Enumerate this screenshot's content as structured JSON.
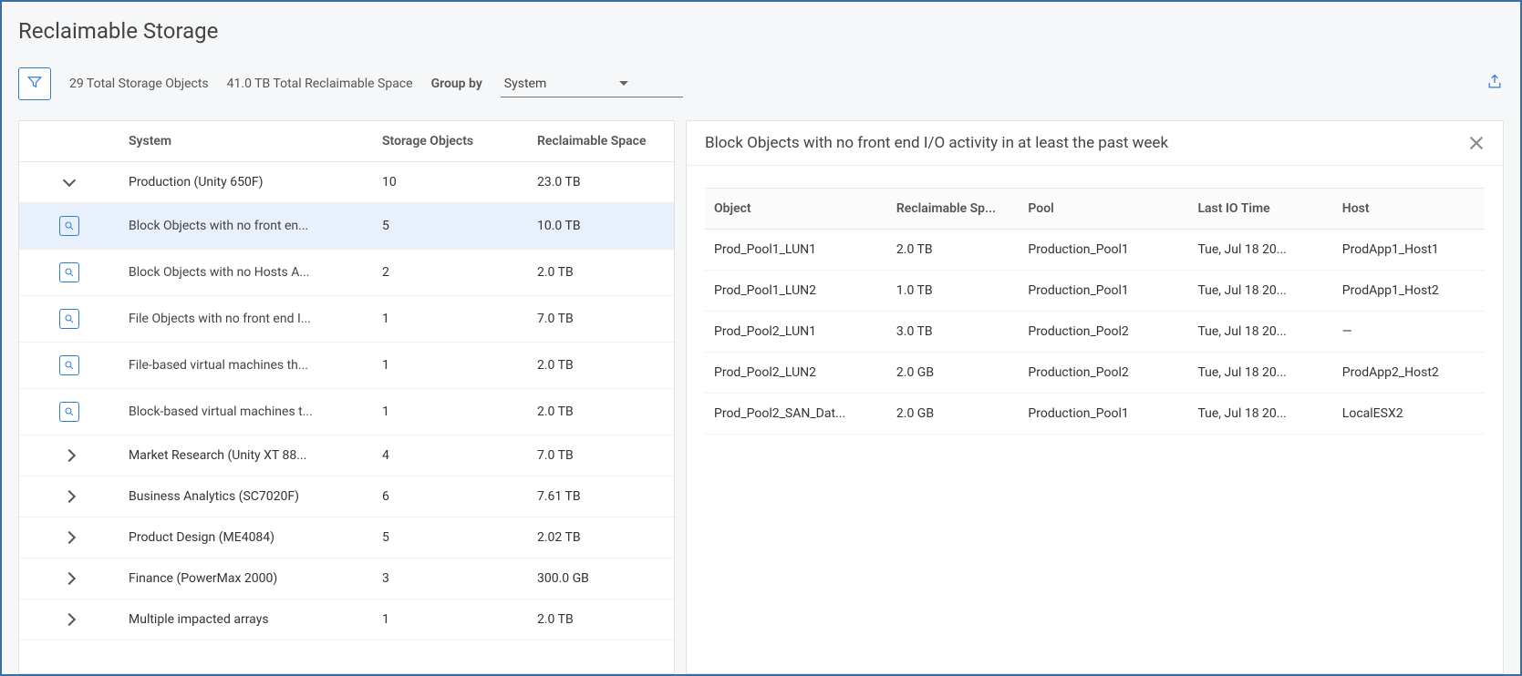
{
  "page_title": "Reclaimable Storage",
  "toolbar": {
    "total_objects": "29 Total Storage Objects",
    "total_reclaimable": "41.0 TB Total Reclaimable Space",
    "group_by_label": "Group by",
    "group_by_value": "System"
  },
  "left": {
    "columns": {
      "system": "System",
      "objects": "Storage Objects",
      "space": "Reclaimable Space"
    },
    "systems": [
      {
        "name": "Production (Unity 650F)",
        "expanded": true,
        "objects": "10",
        "space": "23.0 TB",
        "rules": [
          {
            "name": "Block Objects with no front en...",
            "objects": "5",
            "space": "10.0 TB",
            "selected": true
          },
          {
            "name": "Block Objects with no Hosts A...",
            "objects": "2",
            "space": "2.0 TB"
          },
          {
            "name": "File Objects with no front end I...",
            "objects": "1",
            "space": "7.0 TB"
          },
          {
            "name": "File-based virtual machines th...",
            "objects": "1",
            "space": "2.0 TB"
          },
          {
            "name": "Block-based virtual machines t...",
            "objects": "1",
            "space": "2.0 TB"
          }
        ]
      },
      {
        "name": "Market Research (Unity XT 88...",
        "expanded": false,
        "objects": "4",
        "space": "7.0 TB"
      },
      {
        "name": "Business Analytics (SC7020F)",
        "expanded": false,
        "objects": "6",
        "space": "7.61 TB"
      },
      {
        "name": "Product Design (ME4084)",
        "expanded": false,
        "objects": "5",
        "space": "2.02 TB"
      },
      {
        "name": "Finance (PowerMax 2000)",
        "expanded": false,
        "objects": "3",
        "space": "300.0 GB"
      },
      {
        "name": "Multiple impacted arrays",
        "expanded": false,
        "objects": "1",
        "space": "2.0 TB",
        "nonlink": true
      }
    ]
  },
  "right": {
    "title": "Block Objects with no front end I/O activity in at least the past week",
    "columns": {
      "object": "Object",
      "space": "Reclaimable Sp...",
      "pool": "Pool",
      "last_io": "Last IO Time",
      "host": "Host"
    },
    "rows": [
      {
        "object": "Prod_Pool1_LUN1",
        "space": "2.0 TB",
        "pool": "Production_Pool1",
        "last_io": "Tue, Jul 18 20...",
        "host": "ProdApp1_Host1"
      },
      {
        "object": "Prod_Pool1_LUN2",
        "space": "1.0 TB",
        "pool": "Production_Pool1",
        "last_io": "Tue, Jul 18 20...",
        "host": "ProdApp1_Host2"
      },
      {
        "object": "Prod_Pool2_LUN1",
        "space": "3.0 TB",
        "pool": "Production_Pool2",
        "last_io": "Tue, Jul 18 20...",
        "host": "—"
      },
      {
        "object": "Prod_Pool2_LUN2",
        "space": "2.0 GB",
        "pool": "Production_Pool2",
        "last_io": "Tue, Jul 18 20...",
        "host": "ProdApp2_Host2"
      },
      {
        "object": "Prod_Pool2_SAN_Dat...",
        "space": "2.0 GB",
        "pool": "Production_Pool1",
        "last_io": "Tue, Jul 18 20...",
        "host": "LocalESX2"
      }
    ]
  }
}
